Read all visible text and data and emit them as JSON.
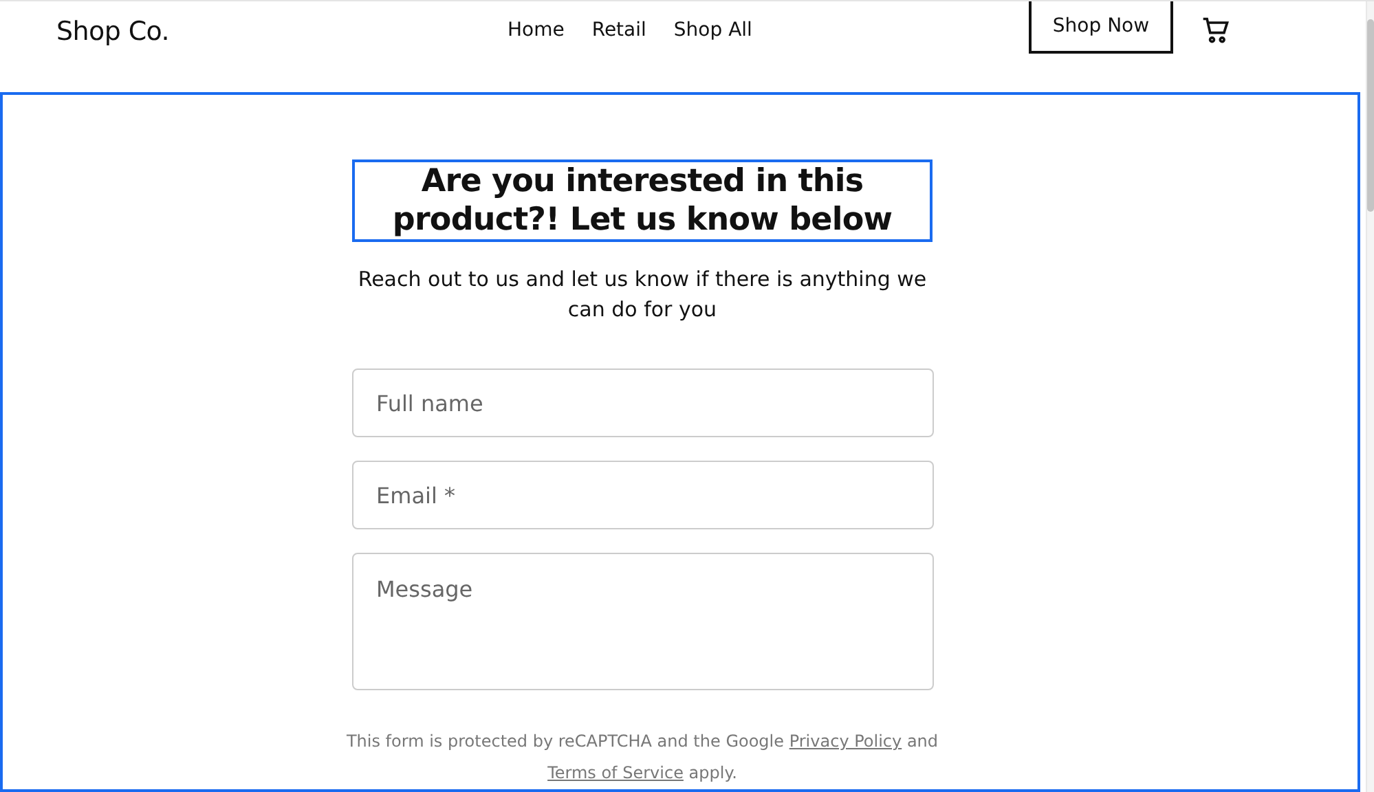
{
  "header": {
    "logo": "Shop Co.",
    "nav": [
      {
        "label": "Home"
      },
      {
        "label": "Retail"
      },
      {
        "label": "Shop All"
      }
    ],
    "cta": "Shop Now"
  },
  "section": {
    "heading": "Are you interested in this product?! Let us know below",
    "subheading": "Reach out to us and let us know if there is anything we can do for you",
    "fields": [
      {
        "kind": "input",
        "placeholder": "Full name"
      },
      {
        "kind": "input",
        "placeholder": "Email *"
      },
      {
        "kind": "textarea",
        "placeholder": "Message"
      }
    ],
    "notice": {
      "before": "This form is protected by reCAPTCHA and the Google",
      "privacy_link": "Privacy Policy",
      "middle": "and",
      "terms_link": "Terms of Service",
      "after": "apply."
    }
  }
}
